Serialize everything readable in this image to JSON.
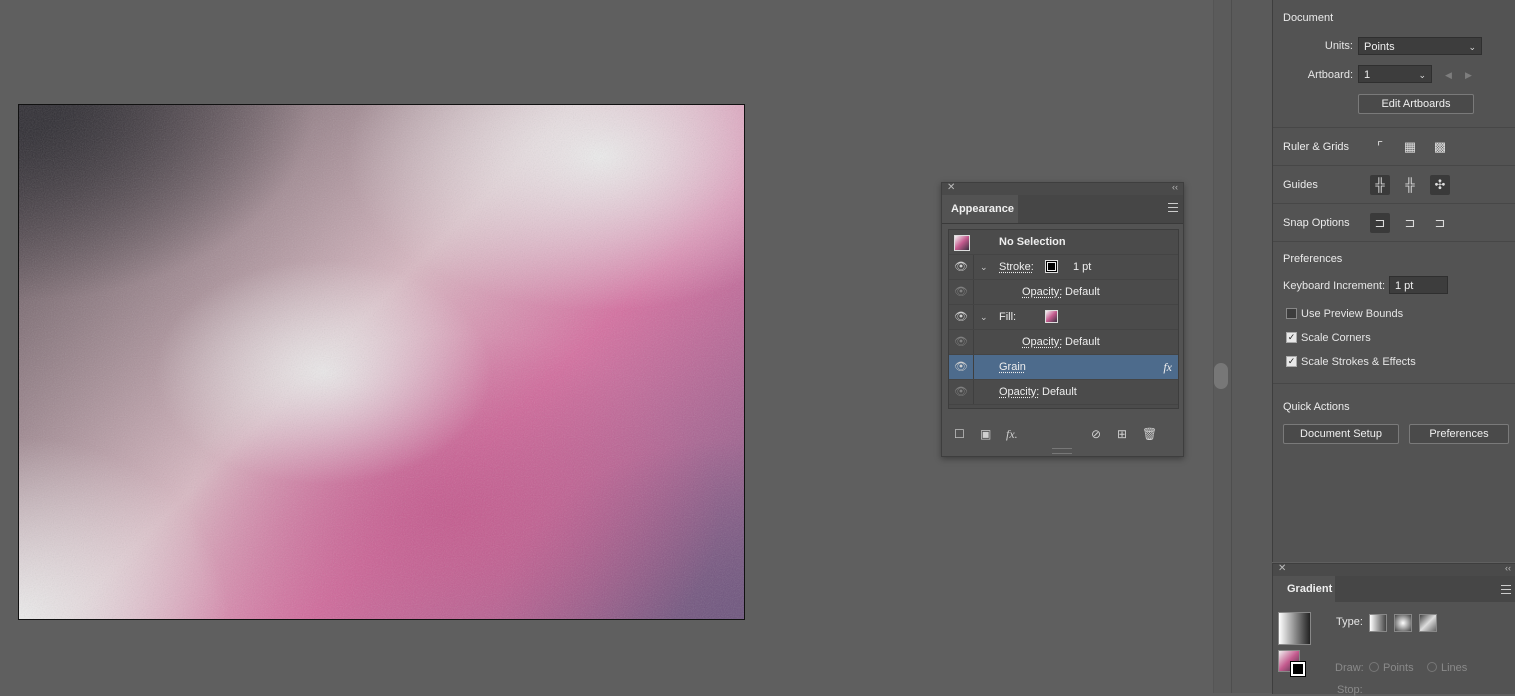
{
  "appearance_panel": {
    "tab_label": "Appearance",
    "header": "No Selection",
    "stroke": {
      "label": "Stroke:",
      "weight": "1 pt",
      "opacity_label": "Opacity:",
      "opacity_value": "Default"
    },
    "fill": {
      "label": "Fill:",
      "opacity_label": "Opacity:",
      "opacity_value": "Default"
    },
    "effect": {
      "label": "Grain",
      "fx": "fx"
    },
    "object_opacity": {
      "label": "Opacity:",
      "value": "Default"
    },
    "footer_icons": [
      "new-stroke-icon",
      "new-fill-icon",
      "fx-icon",
      "clear-appearance-icon",
      "duplicate-icon",
      "trash-icon"
    ]
  },
  "properties_panel": {
    "document_title": "Document",
    "units_label": "Units:",
    "units_value": "Points",
    "artboard_label": "Artboard:",
    "artboard_value": "1",
    "edit_artboards_label": "Edit Artboards",
    "ruler_grids_label": "Ruler & Grids",
    "guides_label": "Guides",
    "snap_options_label": "Snap Options",
    "preferences_title": "Preferences",
    "keyboard_increment_label": "Keyboard Increment:",
    "keyboard_increment_value": "1 pt",
    "use_preview_bounds": {
      "label": "Use Preview Bounds",
      "checked": false
    },
    "scale_corners": {
      "label": "Scale Corners",
      "checked": true
    },
    "scale_strokes": {
      "label": "Scale Strokes & Effects",
      "checked": true
    },
    "quick_actions_title": "Quick Actions",
    "document_setup_label": "Document Setup",
    "preferences_button_label": "Preferences"
  },
  "gradient_panel": {
    "tab_label": "Gradient",
    "type_label": "Type:",
    "draw_label": "Draw:",
    "draw_points": "Points",
    "draw_lines": "Lines",
    "stop_label": "Stop:"
  },
  "colors": {
    "ui_bg": "#5f5f5f",
    "panel_bg": "#535353",
    "selection": "#4d6b8c"
  }
}
